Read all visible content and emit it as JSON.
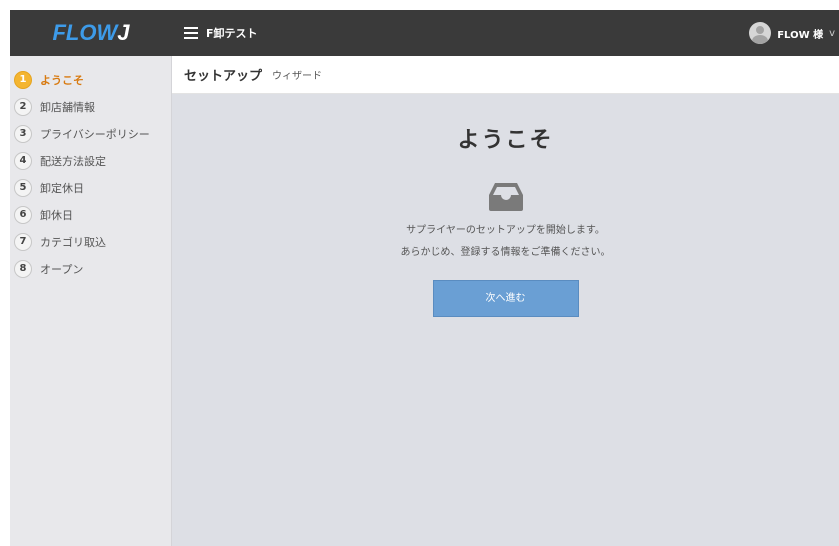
{
  "app": {
    "logo_main": "FLOW",
    "logo_accent": "J",
    "shop_name": "F卸テスト",
    "user_name": "FLOW 様",
    "user_menu_caret": "v"
  },
  "sidebar": {
    "steps": [
      {
        "number": "1",
        "label": "ようこそ",
        "active": true
      },
      {
        "number": "2",
        "label": "卸店舗情報"
      },
      {
        "number": "3",
        "label": "プライバシーポリシー"
      },
      {
        "number": "4",
        "label": "配送方法設定"
      },
      {
        "number": "5",
        "label": "卸定休日"
      },
      {
        "number": "6",
        "label": "卸休日"
      },
      {
        "number": "7",
        "label": "カテゴリ取込"
      },
      {
        "number": "8",
        "label": "オープン"
      }
    ]
  },
  "header": {
    "title": "セットアップ",
    "subtitle": "ウィザード"
  },
  "main": {
    "heading": "ようこそ",
    "icon": "inbox-tray-icon",
    "description_line1": "サプライヤーのセットアップを開始します。",
    "description_line2": "あらかじめ、登録する情報をご準備ください。",
    "next_button": "次へ進む"
  },
  "colors": {
    "topbar": "#3a3a3a",
    "logo_blue": "#3d9be9",
    "active_step": "#f4b531",
    "active_label": "#d87a10",
    "button": "#6a9fd4",
    "content_bg": "#dddfe5"
  }
}
